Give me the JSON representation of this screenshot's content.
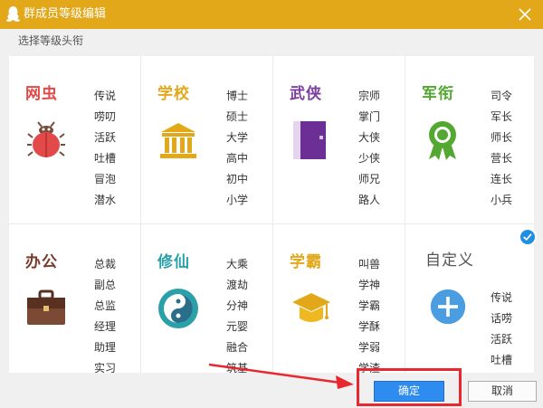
{
  "dialog": {
    "title": "群成员等级编辑",
    "prompt": "选择等级头衔"
  },
  "themes": [
    {
      "name": "网虫",
      "color": "#e24a4a",
      "icon": "bug-icon",
      "ranks": [
        "传说",
        "唠叨",
        "活跃",
        "吐槽",
        "冒泡",
        "潜水"
      ]
    },
    {
      "name": "学校",
      "color": "#e3a81a",
      "icon": "school-building-icon",
      "ranks": [
        "博士",
        "硕士",
        "大学",
        "高中",
        "初中",
        "小学"
      ]
    },
    {
      "name": "武侠",
      "color": "#7b3fa0",
      "icon": "book-icon",
      "ranks": [
        "宗师",
        "掌门",
        "大侠",
        "少侠",
        "师兄",
        "路人"
      ]
    },
    {
      "name": "军衔",
      "color": "#52a830",
      "icon": "medal-icon",
      "ranks": [
        "司令",
        "军长",
        "师长",
        "营长",
        "连长",
        "小兵"
      ]
    },
    {
      "name": "办公",
      "color": "#7a3a2a",
      "icon": "briefcase-icon",
      "ranks": [
        "总裁",
        "副总",
        "总监",
        "经理",
        "助理",
        "实习"
      ]
    },
    {
      "name": "修仙",
      "color": "#2aa0a8",
      "icon": "yin-yang-icon",
      "ranks": [
        "大乘",
        "渡劫",
        "分神",
        "元婴",
        "融合",
        "筑基"
      ]
    },
    {
      "name": "学霸",
      "color": "#e3a81a",
      "icon": "graduation-cap-icon",
      "ranks": [
        "叫兽",
        "学神",
        "学霸",
        "学酥",
        "学弱",
        "学渣"
      ]
    },
    {
      "name": "自定义",
      "color": "#555555",
      "icon": "plus-circle-icon",
      "ranks": [
        "传说",
        "话唠",
        "活跃",
        "吐槽"
      ]
    }
  ],
  "buttons": {
    "ok": "确定",
    "cancel": "取消"
  },
  "colors": {
    "titlebar": "#e3a81a",
    "accent": "#2e8cf0",
    "highlight": "#e8282f"
  }
}
